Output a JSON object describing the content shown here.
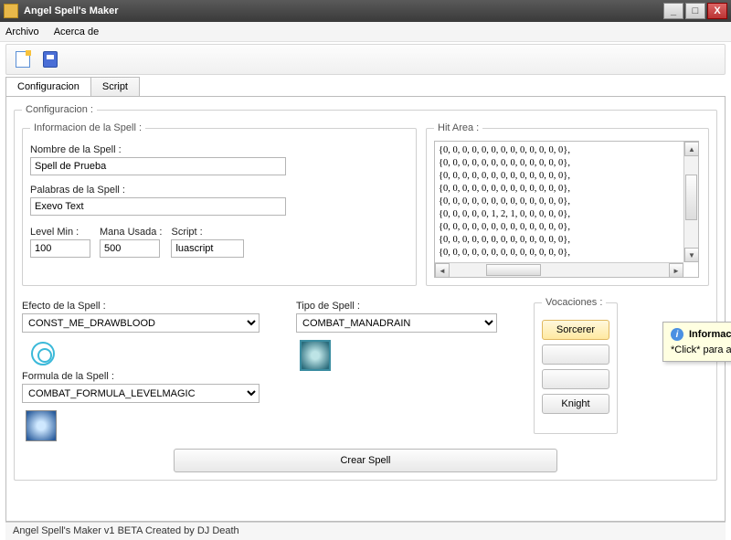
{
  "window": {
    "title": "Angel Spell's Maker"
  },
  "menu": {
    "file": "Archivo",
    "about": "Acerca de"
  },
  "tabs": {
    "config": "Configuracion",
    "script": "Script"
  },
  "groups": {
    "config": "Configuracion :",
    "info": "Informacion de la Spell :",
    "hitarea": "Hit Area :",
    "voc": "Vocaciones :"
  },
  "labels": {
    "name": "Nombre de la Spell :",
    "words": "Palabras de la Spell :",
    "levelmin": "Level Min :",
    "mana": "Mana Usada :",
    "script": "Script :",
    "effect": "Efecto de la Spell :",
    "type": "Tipo de Spell :",
    "formula": "Formula de la Spell :"
  },
  "values": {
    "name": "Spell de Prueba",
    "words": "Exevo Text",
    "levelmin": "100",
    "mana": "500",
    "script": "luascript",
    "effect": "CONST_ME_DRAWBLOOD",
    "type": "COMBAT_MANADRAIN",
    "formula": "COMBAT_FORMULA_LEVELMAGIC"
  },
  "hitarea_lines": [
    "{0, 0, 0, 0, 0, 0, 0, 0, 0, 0, 0, 0, 0},",
    "{0, 0, 0, 0, 0, 0, 0, 0, 0, 0, 0, 0, 0},",
    "{0, 0, 0, 0, 0, 0, 0, 0, 0, 0, 0, 0, 0},",
    "{0, 0, 0, 0, 0, 0, 0, 0, 0, 0, 0, 0, 0},",
    "{0, 0, 0, 0, 0, 0, 0, 0, 0, 0, 0, 0, 0},",
    "{0, 0, 0, 0, 0, 1, 2, 1, 0, 0, 0, 0, 0},",
    "{0, 0, 0, 0, 0, 0, 0, 0, 0, 0, 0, 0, 0},",
    "{0, 0, 0, 0, 0, 0, 0, 0, 0, 0, 0, 0, 0},",
    "{0, 0, 0, 0, 0, 0, 0, 0, 0, 0, 0, 0, 0},"
  ],
  "voc": {
    "sorcerer": "Sorcerer",
    "knight": "Knight"
  },
  "buttons": {
    "create": "Crear Spell"
  },
  "tooltip": {
    "title": "Información",
    "body": "*Click* para añadir la vocacion de Sorcerer"
  },
  "status": "Angel Spell's Maker v1 BETA Created by DJ Death"
}
